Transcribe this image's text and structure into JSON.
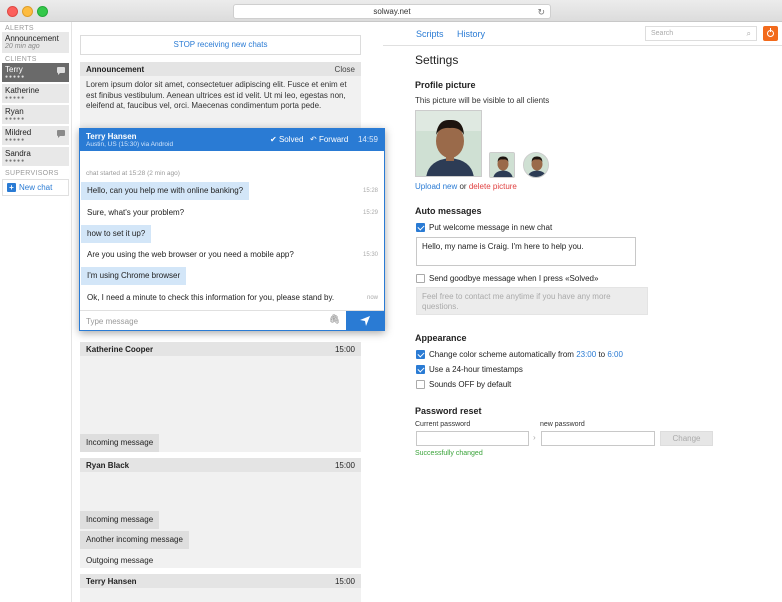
{
  "browser": {
    "url": "solway.net"
  },
  "sidebar": {
    "alerts_label": "ALERTS",
    "announcement": {
      "label": "Announcement",
      "sub": "20 min ago"
    },
    "clients_label": "CLIENTS",
    "clients": [
      {
        "name": "Terry",
        "active": true,
        "chat": true
      },
      {
        "name": "Katherine",
        "active": false,
        "chat": false
      },
      {
        "name": "Ryan",
        "active": false,
        "chat": false
      },
      {
        "name": "Mildred",
        "active": false,
        "chat": true
      },
      {
        "name": "Sandra",
        "active": false,
        "chat": false
      }
    ],
    "dots": "●●●●●",
    "supervisors_label": "SUPERVISORS",
    "new_chat": "New chat"
  },
  "middle": {
    "stop_button": "STOP receiving new chats",
    "announcement": {
      "title": "Announcement",
      "close": "Close",
      "body": "Lorem ipsum dolor sit amet, consectetuer adipiscing elit. Fusce et enim et est finibus vestibulum. Aenean ultrices est id velit. Ut mi leo, egestas non, eleifend at, faucibus vel, orci. Maecenas condimentum porta pede."
    },
    "active_chat": {
      "name": "Terry Hansen",
      "location": "Austin, US (15:30) via Android",
      "solved": "Solved",
      "forward": "Forward",
      "time": "14:59",
      "started": "chat started at 15:28 (2 min ago)",
      "messages": [
        {
          "text": "Hello, can you help me with online banking?",
          "dir": "in",
          "time": "15:28"
        },
        {
          "text": "Sure, what's your problem?",
          "dir": "out",
          "time": "15:29"
        },
        {
          "text": "how to set it up?",
          "dir": "in",
          "time": ""
        },
        {
          "text": "Are you using the web browser or you need a mobile app?",
          "dir": "out",
          "time": "15:30"
        },
        {
          "text": "I'm using Chrome browser",
          "dir": "in",
          "time": ""
        },
        {
          "text": "Ok, I need a minute to check this information for you, please stand by.",
          "dir": "out",
          "time": "now"
        }
      ],
      "composer_placeholder": "Type message"
    },
    "cards": [
      {
        "name": "Katherine Cooper",
        "time": "15:00",
        "messages": [
          "Incoming message"
        ]
      },
      {
        "name": "Ryan Black",
        "time": "15:00",
        "messages": [
          "Incoming message",
          "Another incoming message",
          "Outgoing message"
        ]
      },
      {
        "name": "Terry Hansen",
        "time": "15:00",
        "messages": []
      }
    ]
  },
  "right": {
    "tabs": [
      "Scripts",
      "History"
    ],
    "search_placeholder": "Search",
    "settings": {
      "title": "Settings",
      "profile_picture": {
        "heading": "Profile picture",
        "desc": "This picture will be visible to all clients",
        "upload": "Upload new",
        "or": "or",
        "delete": "delete picture"
      },
      "auto_messages": {
        "heading": "Auto messages",
        "welcome_label": "Put welcome message in new chat",
        "welcome_checked": true,
        "welcome_text": "Hello, my name is Craig. I'm here to help you.",
        "goodbye_label": "Send goodbye message when I press «Solved»",
        "goodbye_checked": false,
        "goodbye_text": "Feel free to contact me anytime if you have any more questions."
      },
      "appearance": {
        "heading": "Appearance",
        "scheme_label": "Change color scheme automatically from",
        "scheme_from": "23:00",
        "scheme_to_word": "to",
        "scheme_to": "6:00",
        "scheme_checked": true,
        "ts_label": "Use a 24-hour timestamps",
        "ts_checked": true,
        "sound_label": "Sounds OFF by default",
        "sound_checked": false
      },
      "password": {
        "heading": "Password reset",
        "current_label": "Current password",
        "new_label": "new password",
        "change_button": "Change",
        "status": "Successfully changed"
      }
    }
  },
  "colors": {
    "accent": "#2a7bd4",
    "success": "#3aa33a",
    "danger": "#e04040",
    "brand": "#f26a1b"
  }
}
